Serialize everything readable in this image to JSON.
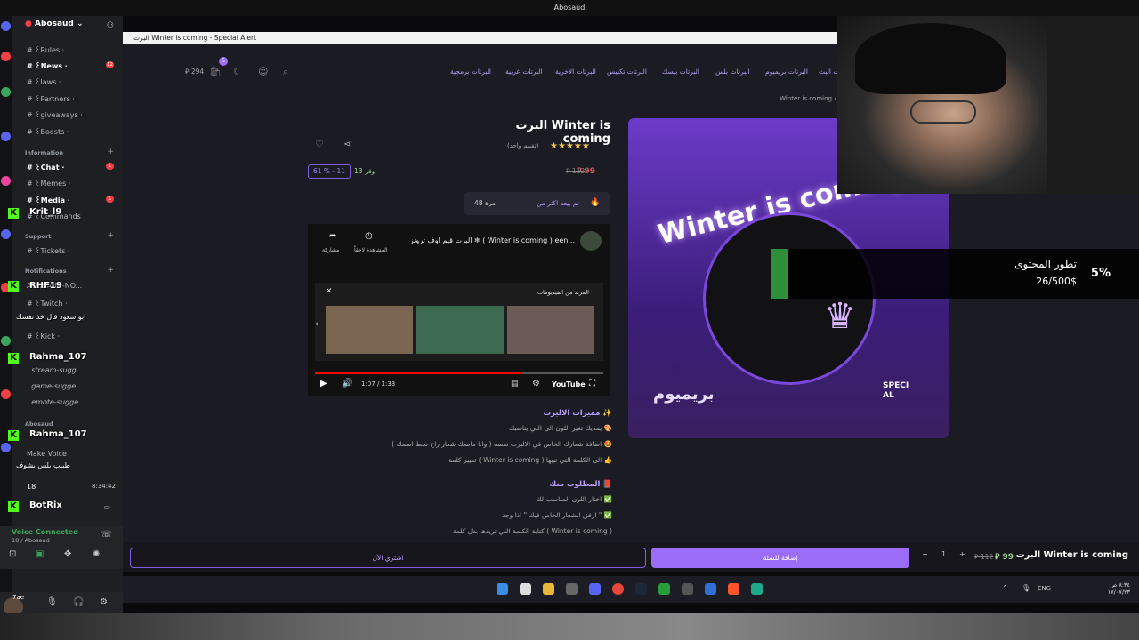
{
  "topbar": {
    "title": "Abosaud"
  },
  "discord": {
    "server_name": "Abosaud",
    "channels": [
      {
        "label": "# ꒰Rules ·",
        "badge": ""
      },
      {
        "label": "# ꒰News ·",
        "badge": "12"
      },
      {
        "label": "# ꒰laws ·",
        "badge": ""
      },
      {
        "label": "# ꒰Partners ·",
        "badge": ""
      },
      {
        "label": "# ꒰giveaways ·",
        "badge": ""
      },
      {
        "label": "# ꒰Boosts ·",
        "badge": ""
      }
    ],
    "cat_information": "Information",
    "info_channels": [
      {
        "label": "# ꒰Chat ·",
        "badge": "1"
      },
      {
        "label": "# ꒰Memes ·",
        "badge": ""
      },
      {
        "label": "# ꒰Media ·",
        "badge": "1"
      },
      {
        "label": "# ꒰Commands",
        "badge": ""
      }
    ],
    "cat_support": "Support",
    "support_channels": [
      {
        "label": "# ꒰Tickets ·"
      }
    ],
    "cat_notifications": "Notifications",
    "notif_channels": [
      {
        "label": "ABOSAUD-NO..."
      },
      {
        "label": "# ꒰Twitch ·"
      },
      {
        "label": "# ꒰Kick ·"
      }
    ],
    "suggest_channels": [
      {
        "label": "| stream-sugg..."
      },
      {
        "label": "| game-sugge..."
      },
      {
        "label": "| emote-sugge..."
      }
    ],
    "cat_abosaud": "Abosaud",
    "make_voice": "Make Voice",
    "voice_count": "18",
    "voice_time": "8:34:42",
    "voice_status": "Voice Connected",
    "voice_channel": "18 / Abosaud",
    "username": "7ae",
    "overlay_names": [
      "Krit_l9",
      "RHF19",
      "ابو سعود قال خذ نفسك",
      "Rahma_107",
      "Rahma_107",
      "طبيب بلس يشوف",
      "BotRix"
    ]
  },
  "browser": {
    "tab_title": "البرت Winter is coming - Special Alert"
  },
  "site": {
    "nav_items": [
      "البرت البث",
      "البرتات بريميوم",
      "البرتات بلس",
      "البرتات بيسك",
      "البرتات تكبيس",
      "البرتات الأخرية",
      "البرتات عربية",
      "البرتات برمجية"
    ],
    "cart_count": "5",
    "cart_price": "294",
    "breadcrumb": "Winter is coming ‹",
    "product_title": "البرت Winter is coming",
    "rating_stars": "★★★★★",
    "rating_count": "(تقييم واحد)",
    "price": "99",
    "old_price": "112",
    "save": "وفر 13",
    "discount": "61 % - 11",
    "sold_label": "تم بيعه اكثر من",
    "sold_count": "48 مرة",
    "video_title": "البرت قيم اوف ثرونز ❄ ( Winter is coming ) een...",
    "video_share": "مشاركة",
    "video_watch_later": "المشاهدة لاحقاً",
    "video_more": "المزيد من الفيديوهات",
    "video_time": "1:07 / 1:33",
    "video_brand": "YouTube",
    "product_image_text": "Winter is coming",
    "product_image_badge": "بريميوم",
    "product_image_logo": "SPECIAL",
    "features_heading": "مميزات الاليرت ✨",
    "features": [
      "يمديك تغير اللون الى اللي يناسبك 🎨",
      "اضافة شعارك الخاص في الاليرت نفسه ( وانا مامعك شعار راح نحط اسمك ) 🤩",
      "تغيير كلمة ( Winter is coming ) الى الكلمة التي تبيها 👍"
    ],
    "required_heading": "المطلوب منك 📕",
    "required": [
      "اختار اللون المناسب لك ✅",
      "ارفق الشعار الخاص فيك \" اذا وجد \" ✅",
      "كتابة الكلمة اللي تريدها بدل كلمة ( Winter is coming )"
    ]
  },
  "bottombar": {
    "title": "البرت Winter is coming",
    "price": "99",
    "old_price": "112",
    "qty": "1",
    "add_to_cart": "إضافة للسلة",
    "buy_now": "اشتري الآن"
  },
  "tray": {
    "lang": "ENG",
    "time": "٨:٣٤ ص",
    "date": "١٧/٠٧/٢٣"
  },
  "goal": {
    "title": "تطور المحتوى",
    "amount": "26/500$",
    "percent": "5%",
    "progress": 0.05
  }
}
